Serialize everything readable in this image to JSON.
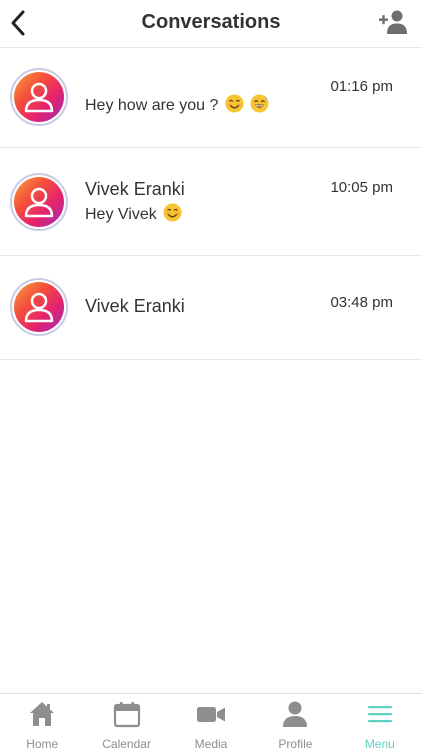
{
  "header": {
    "title": "Conversations",
    "back_icon": "chevron-left-icon",
    "add_contact_icon": "add-person-icon"
  },
  "conversations": [
    {
      "name": "",
      "preview": "Hey how are you ?",
      "preview_emojis": [
        "smiling-face-emoji",
        "grinning-sweat-emoji"
      ],
      "time": "01:16 pm"
    },
    {
      "name": "Vivek Eranki",
      "preview": "Hey Vivek",
      "preview_emojis": [
        "smiling-face-emoji"
      ],
      "time": "10:05 pm"
    },
    {
      "name": "Vivek Eranki",
      "preview": "",
      "preview_emojis": [],
      "time": "03:48 pm"
    }
  ],
  "tabbar": {
    "items": [
      {
        "label": "Home",
        "icon": "home-icon",
        "active": false
      },
      {
        "label": "Calendar",
        "icon": "calendar-icon",
        "active": false
      },
      {
        "label": "Media",
        "icon": "video-camera-icon",
        "active": false
      },
      {
        "label": "Profile",
        "icon": "person-icon",
        "active": false
      },
      {
        "label": "Menu",
        "icon": "hamburger-menu-icon",
        "active": true
      }
    ]
  },
  "colors": {
    "accent": "#5fd3c2",
    "tab_inactive": "#8e8e8e",
    "avatar_gradient": [
      "#f9a23c",
      "#f4503b",
      "#e6236d",
      "#9c2bb6"
    ]
  }
}
